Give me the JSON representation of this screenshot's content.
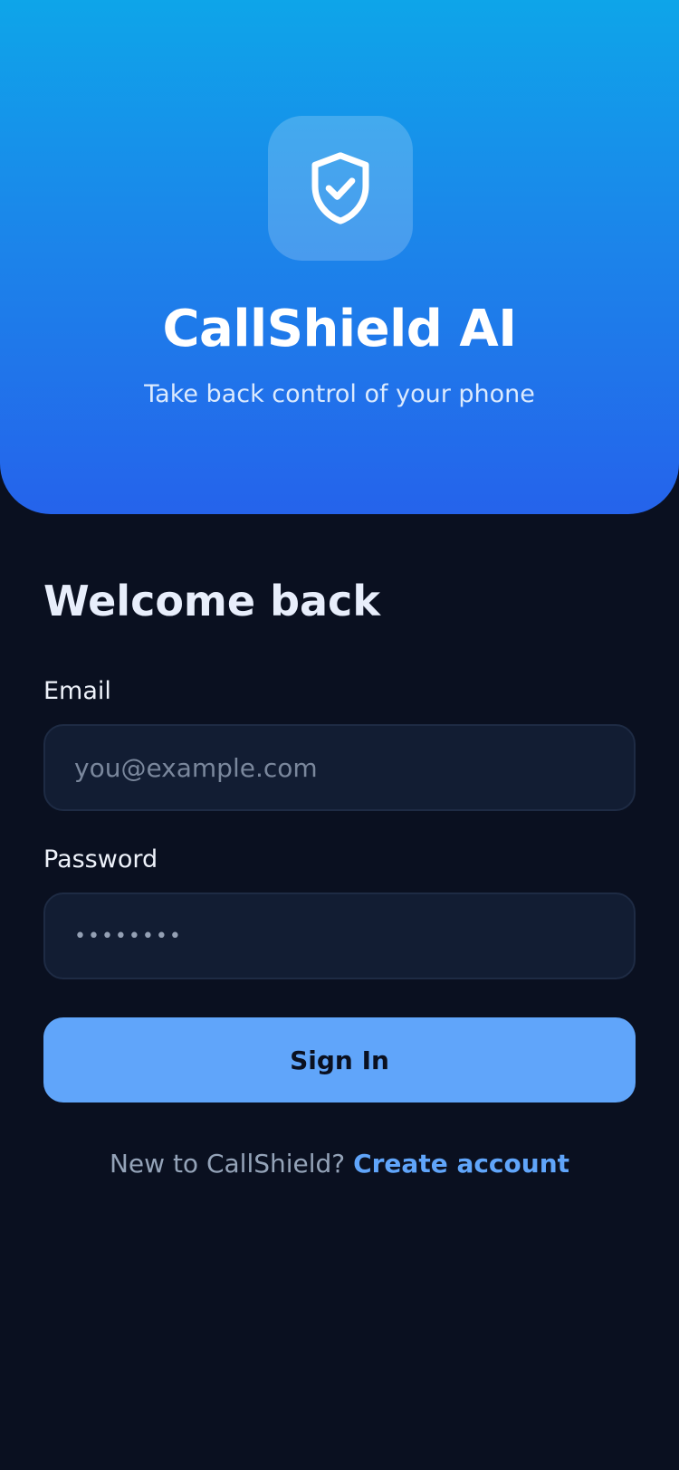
{
  "header": {
    "logo_icon": "shield-check-icon",
    "title": "CallShield AI",
    "subtitle": "Take back control of your phone"
  },
  "form": {
    "heading": "Welcome back",
    "email": {
      "label": "Email",
      "placeholder": "you@example.com",
      "value": ""
    },
    "password": {
      "label": "Password",
      "masked_value": "••••••••"
    },
    "submit_label": "Sign In"
  },
  "footer": {
    "prompt": "New to CallShield?",
    "link_label": "Create account"
  },
  "colors": {
    "background": "#0a1020",
    "gradient_top": "#0ea5e9",
    "gradient_bottom": "#2563eb",
    "accent": "#60a5fa",
    "input_bg": "#121d33"
  }
}
